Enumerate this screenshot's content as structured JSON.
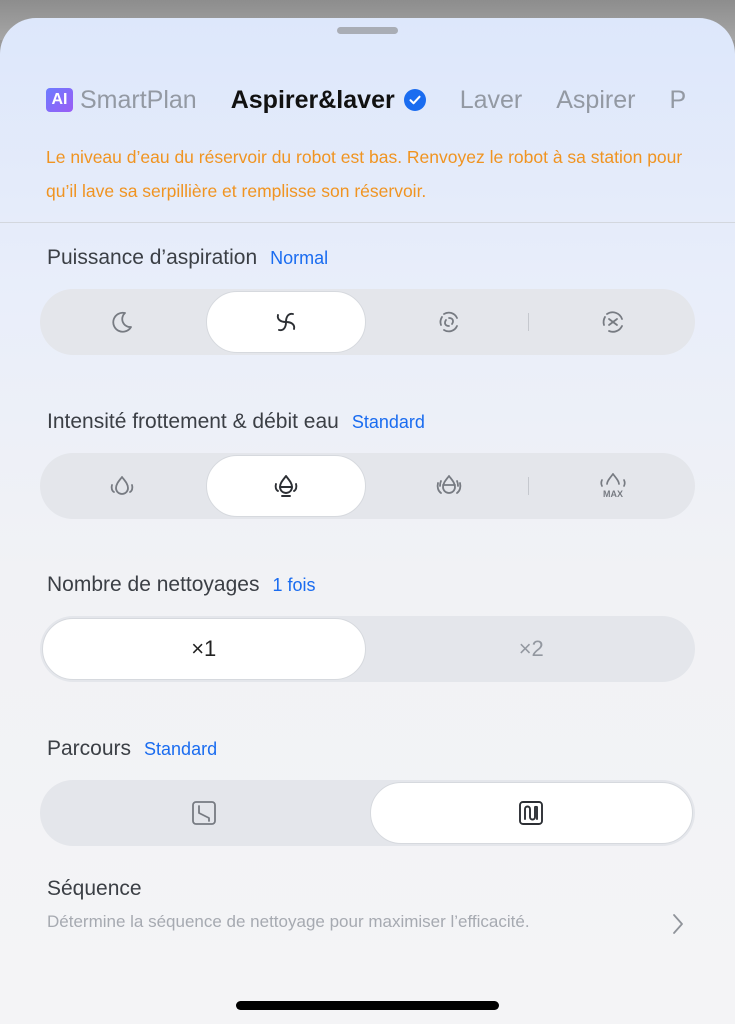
{
  "tabs": {
    "ai_badge": "AI",
    "items": [
      "SmartPlan",
      "Aspirer&laver",
      "Laver",
      "Aspirer",
      "P"
    ]
  },
  "warning": "Le niveau d’eau du réservoir du robot est bas. Renvoyez le robot à sa station pour qu’il lave sa serpillière et remplisse son réservoir.",
  "suction": {
    "label": "Puissance d’aspiration",
    "value": "Normal",
    "options": [
      "quiet-icon",
      "suction-normal-icon",
      "suction-strong-icon",
      "suction-max-icon"
    ],
    "selected_index": 1
  },
  "mop": {
    "label": "Intensité frottement & débit eau",
    "value": "Standard",
    "options": [
      "water-low-icon",
      "water-standard-icon",
      "water-high-icon",
      "water-max-icon"
    ],
    "max_text": "MAX",
    "selected_index": 1
  },
  "passes": {
    "label": "Nombre de nettoyages",
    "value": "1 fois",
    "options": [
      "×1",
      "×2"
    ],
    "selected_index": 0
  },
  "route": {
    "label": "Parcours",
    "value": "Standard",
    "options": [
      "route-quick-icon",
      "route-standard-icon"
    ],
    "selected_index": 1
  },
  "sequence": {
    "title": "Séquence",
    "description": "Détermine la séquence de nettoyage pour maximiser l’efficacité."
  },
  "colors": {
    "accent": "#1a6cf0",
    "warning": "#f09421"
  }
}
